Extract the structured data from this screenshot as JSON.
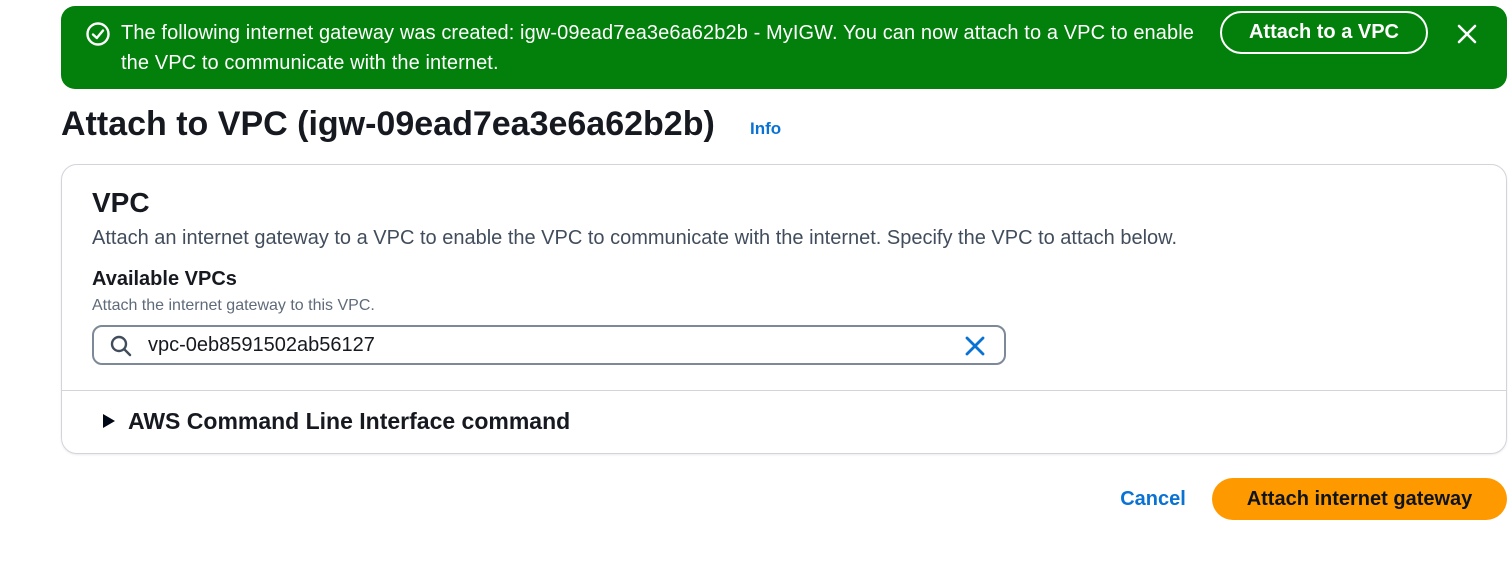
{
  "flashbar": {
    "message": "The following internet gateway was created: igw-09ead7ea3e6a62b2b - MyIGW. You can now attach to a VPC to enable the VPC to communicate with the internet.",
    "action_label": "Attach to a VPC",
    "status_icon": "success-circle-check-icon",
    "dismiss_icon": "close-icon",
    "color": "#037f0c"
  },
  "header": {
    "title": "Attach to VPC (igw-09ead7ea3e6a62b2b)",
    "info_label": "Info"
  },
  "vpc_section": {
    "heading": "VPC",
    "description": "Attach an internet gateway to a VPC to enable the VPC to communicate with the internet. Specify the VPC to attach below.",
    "field": {
      "label": "Available VPCs",
      "hint": "Attach the internet gateway to this VPC.",
      "value": "vpc-0eb8591502ab56127",
      "search_icon": "search-icon",
      "clear_icon": "clear-x-icon"
    },
    "expander": {
      "label": "AWS Command Line Interface command",
      "icon": "caret-right-icon",
      "expanded": false
    }
  },
  "actions": {
    "cancel_label": "Cancel",
    "primary_label": "Attach internet gateway",
    "primary_color": "#ff9900",
    "link_color": "#0972d3"
  }
}
